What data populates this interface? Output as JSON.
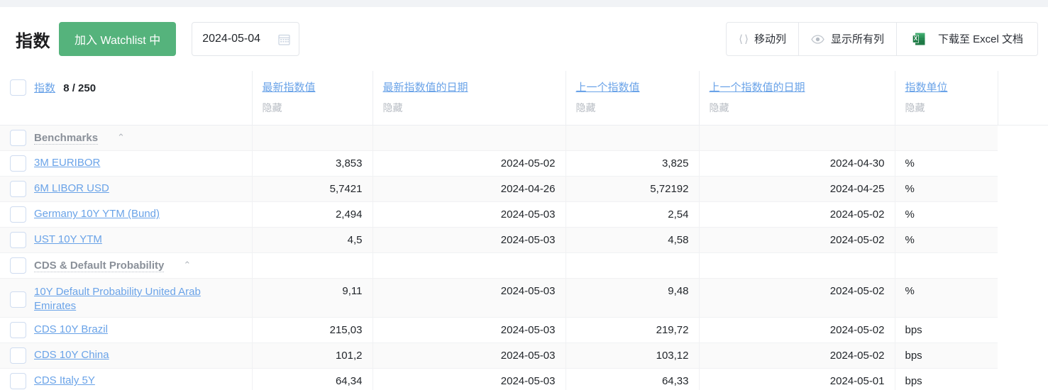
{
  "header": {
    "title": "指数",
    "watchlist_button": "加入 Watchlist 中",
    "date_value": "2024-05-04",
    "calendar_icon": "calendar-icon",
    "buttons": [
      {
        "label": "移动列",
        "icon": "move-columns-icon"
      },
      {
        "label": "显示所有列",
        "icon": "eye-icon"
      },
      {
        "label": "下载至 Excel 文档",
        "icon": "excel-icon"
      }
    ]
  },
  "table": {
    "name_column": {
      "label": "指数",
      "count": "8 / 250"
    },
    "columns": [
      {
        "label": "最新指数值",
        "hide": "隐藏"
      },
      {
        "label": "最新指数值的日期",
        "hide": "隐藏"
      },
      {
        "label": "上一个指数值",
        "hide": "隐藏"
      },
      {
        "label": "上一个指数值的日期",
        "hide": "隐藏"
      },
      {
        "label": "指数单位",
        "hide": "隐藏"
      }
    ],
    "rows": [
      {
        "type": "group",
        "name": "Benchmarks",
        "latest": "",
        "latest_date": "",
        "previous": "",
        "previous_date": "",
        "unit": ""
      },
      {
        "type": "item",
        "name": "3M EURIBOR",
        "latest": "3,853",
        "latest_date": "2024-05-02",
        "previous": "3,825",
        "previous_date": "2024-04-30",
        "unit": "%"
      },
      {
        "type": "item",
        "name": "6M LIBOR USD",
        "latest": "5,7421",
        "latest_date": "2024-04-26",
        "previous": "5,72192",
        "previous_date": "2024-04-25",
        "unit": "%"
      },
      {
        "type": "item",
        "name": "Germany 10Y YTM (Bund)",
        "latest": "2,494",
        "latest_date": "2024-05-03",
        "previous": "2,54",
        "previous_date": "2024-05-02",
        "unit": "%"
      },
      {
        "type": "item",
        "name": "UST 10Y YTM",
        "latest": "4,5",
        "latest_date": "2024-05-03",
        "previous": "4,58",
        "previous_date": "2024-05-02",
        "unit": "%"
      },
      {
        "type": "group",
        "name": "CDS & Default Probability",
        "latest": "",
        "latest_date": "",
        "previous": "",
        "previous_date": "",
        "unit": ""
      },
      {
        "type": "item",
        "name": "10Y Default Probability United Arab Emirates",
        "latest": "9,11",
        "latest_date": "2024-05-03",
        "previous": "9,48",
        "previous_date": "2024-05-02",
        "unit": "%",
        "tall": true
      },
      {
        "type": "item",
        "name": "CDS 10Y Brazil",
        "latest": "215,03",
        "latest_date": "2024-05-03",
        "previous": "219,72",
        "previous_date": "2024-05-02",
        "unit": "bps"
      },
      {
        "type": "item",
        "name": "CDS 10Y China",
        "latest": "101,2",
        "latest_date": "2024-05-03",
        "previous": "103,12",
        "previous_date": "2024-05-02",
        "unit": "bps"
      },
      {
        "type": "item",
        "name": "CDS Italy 5Y",
        "latest": "64,34",
        "latest_date": "2024-05-03",
        "previous": "64,33",
        "previous_date": "2024-05-01",
        "unit": "bps"
      }
    ]
  },
  "colors": {
    "accent_green": "#55b37c",
    "link_blue": "#6aa3e8",
    "stripe": "#fafafa",
    "muted": "#b7bcc3"
  }
}
